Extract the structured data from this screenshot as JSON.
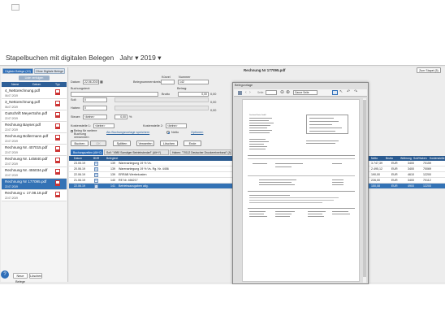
{
  "app": {
    "title": "Stapelbuchen mit digitalen Belegen",
    "year_label": "Jahr",
    "year_value": "2019"
  },
  "left": {
    "tabs": [
      "Digitale Belege (10)",
      "Ohne Digitale Belege"
    ],
    "add_button": "Liste verfolgen",
    "headers": [
      "Name",
      "Datum",
      "Typ"
    ],
    "items": [
      {
        "name": "4_Nettorechnung.pdf",
        "date": "06.07.2019"
      },
      {
        "name": "3_Nettorechnung.pdf",
        "date": "06.07.2019"
      },
      {
        "name": "Gutschrift MeyerSohn.pdf",
        "date": "22.07.2019"
      },
      {
        "name": "Rechnung Bayser.pdf",
        "date": "22.07.2019"
      },
      {
        "name": "Rechnung Bollermann.pdf",
        "date": "22.07.2019"
      },
      {
        "name": "Rechnung Nr. 407015.pdf",
        "date": "22.07.2019"
      },
      {
        "name": "Rechnung Nr. 145840.pdf",
        "date": "22.07.2019"
      },
      {
        "name": "Rechnung Nr. 455034.pdf",
        "date": "22.07.2019"
      },
      {
        "name": "Rechnung Nr 177095.pdf",
        "date": "22.07.2019"
      },
      {
        "name": "Rechnung v. 17.08.18.pdf",
        "date": "22.07.2019"
      }
    ],
    "selected_index": 8,
    "footer_buttons": [
      "Neue Belege",
      "Löschen"
    ]
  },
  "form": {
    "doc_title": "Rechnung Nr 177095.pdf",
    "stapel_button": "Zum Stapel (5)",
    "datum_label": "Datum:",
    "datum_value": "22.06.2019",
    "belegnummernkreis_label": "Belegnummernkreis:",
    "buchungstext_label": "Buchungstext:",
    "kuerzel_label": "Kürzel",
    "nummer_label": "Nummer",
    "nummer_value": "142",
    "betrag_label": "Betrag:",
    "brutto_label": "Brutto",
    "betrag_value": "0,00",
    "soll_label": "Soll:",
    "soll_value": "0",
    "haben_label": "Haben:",
    "haben_value": "0",
    "steuer_label": "Steuer:",
    "steuer_value": "<keine>",
    "steuer_amount": "0,00",
    "steuer_pct": "%",
    "side_values": [
      "0,00",
      "0,00",
      "0,00"
    ],
    "kostenstelle1_label": "Kostenstelle 1:",
    "kostenstelle1_value": "<keine>",
    "kostenstelle2_label": "Kostenstelle 2:",
    "kostenstelle2_value": "<keine>",
    "checkbox_label": "Beleg für weitere Buchung verwenden",
    "link_label": "Als Buchungsvorlage speichern",
    "radio_label": "Netto",
    "optionen_label": "Optionen",
    "action_buttons": [
      "Buchen",
      "OK",
      "Splitten",
      "Verwerfen",
      "Löschen",
      "Ende"
    ]
  },
  "table": {
    "tabs": [
      "Buchungszeilen (Alt+C)",
      "Soll: \"4980 Sonstiger Betriebsbedarf\" (Alt+Y)",
      "Haben: \"70112 Deutscher Druckereiverband\" (Alt+X)"
    ],
    "headers": [
      "Datum",
      "BNR",
      "Belegtext",
      "Netto",
      "Brutto",
      "Währung",
      "Soll/Haben",
      "Kostenstelle"
    ],
    "rows": [
      {
        "date": "23.05.19",
        "bnr": "139",
        "text": "Warenanlegung 19 % Vs.",
        "netto": "3.747,39",
        "waehrung": "EUR",
        "soll": "3400",
        "haben": "70159"
      },
      {
        "date": "20.06.19",
        "bnr": "139",
        "text": "Warenanlegung 19 % Vs. Rg. Nr. 4456",
        "netto": "2.495,12",
        "waehrung": "EUR",
        "soll": "3400",
        "haben": "70069"
      },
      {
        "date": "22.06.19",
        "bnr": "139",
        "text": "ERRAB Werbekosten",
        "netto": "190,00",
        "waehrung": "EUR",
        "soll": "4610",
        "haben": "12200"
      },
      {
        "date": "21.06.19",
        "bnr": "140",
        "text": "RE Nr. 466217",
        "netto": "226,00",
        "waehrung": "EUR",
        "soll": "3400",
        "haben": "70112"
      },
      {
        "date": "22.06.19",
        "bnr": "141",
        "text": "Betriebsausgaben allg.",
        "netto": "150,08",
        "waehrung": "EUR",
        "soll": "4900",
        "haben": "12200"
      }
    ],
    "selected_row": 4
  },
  "preview": {
    "title": "Belegvorlage",
    "page_label": "Seite:",
    "zoom_label": "Ganze Seite"
  },
  "colors": {
    "accent": "#2e6eb8",
    "header": "#2a5a90",
    "selection": "#3372b5"
  }
}
